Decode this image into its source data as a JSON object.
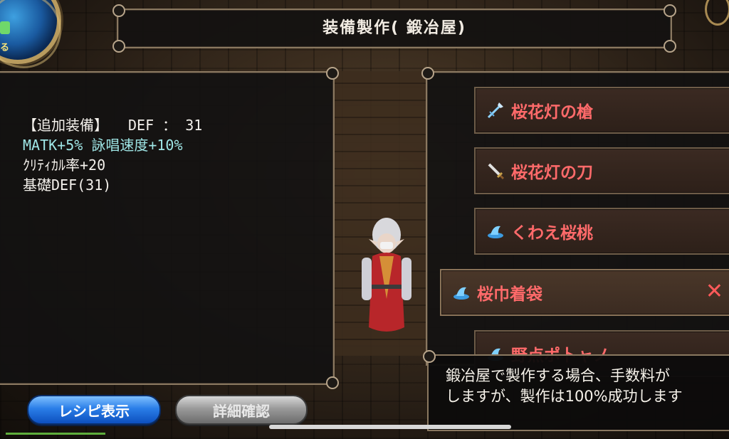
{
  "header": {
    "title": "装備製作(  鍛冶屋)"
  },
  "stats": {
    "bonus_label": "【追加装備】",
    "def_label": "DEF  ：  31",
    "matk_line": "MATK+5% 詠唱速度+10%",
    "crit_line": "ｸﾘﾃｨｶﾙ率+20",
    "base_def_line": "基礎DEF(31)"
  },
  "recipes": [
    {
      "name": "桜花灯の槍",
      "icon": "spear-icon"
    },
    {
      "name": "桜花灯の刀",
      "icon": "sword-icon"
    },
    {
      "name": "くわえ桜桃",
      "icon": "headgear-icon"
    },
    {
      "name": "桜巾着袋",
      "icon": "headgear-icon",
      "selected": true
    },
    {
      "name": "野点ポ卜ャノ",
      "icon": "headgear-icon"
    }
  ],
  "message": {
    "line1": "鍛冶屋で製作する場合、手数料が",
    "line2": "しますが、製作は100%成功します"
  },
  "buttons": {
    "recipe_label": "レシピ表示",
    "detail_label": "詳細確認"
  },
  "hud": {
    "orb_glyph": "る"
  },
  "colors": {
    "recipe_name": "#ff6a6a",
    "stat_cyan": "#9fe6e6",
    "button_blue": "#2a7ee8",
    "button_gray": "#9a9a9a"
  }
}
